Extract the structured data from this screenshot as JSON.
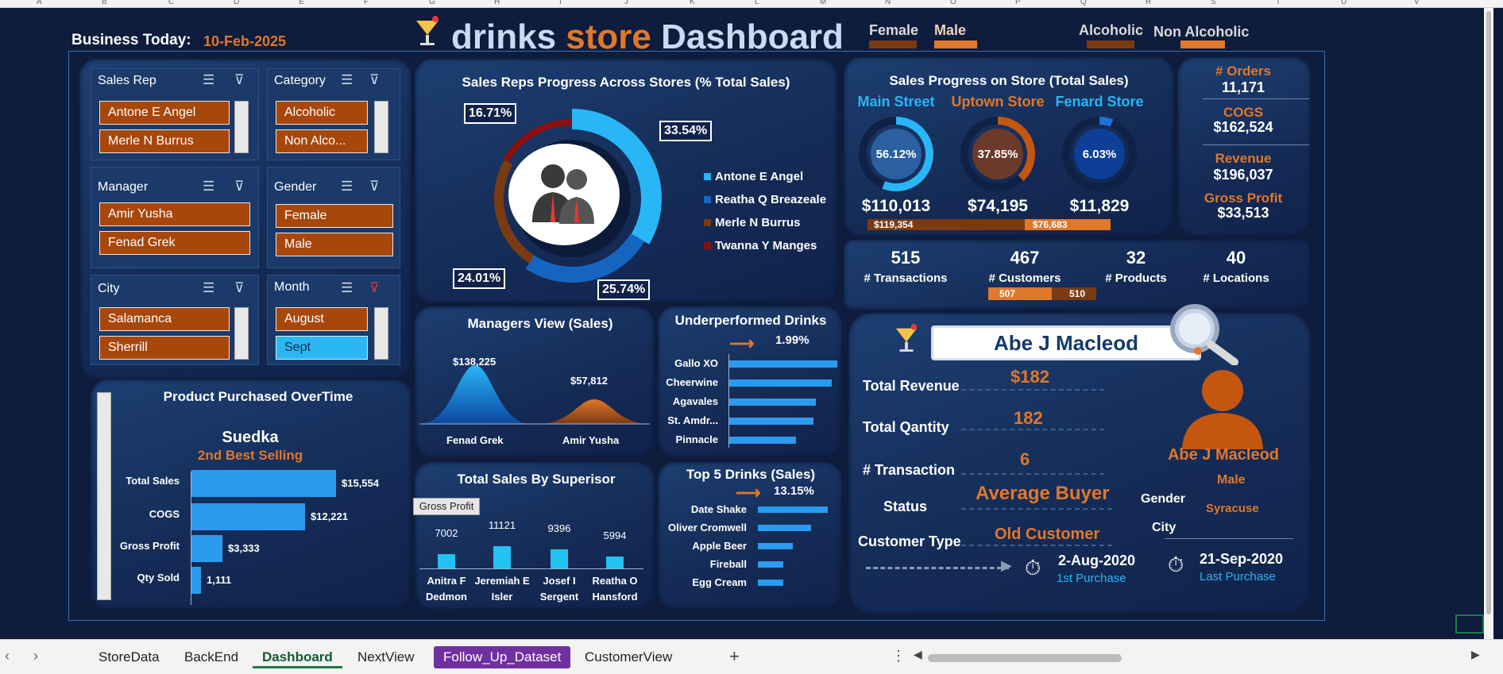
{
  "columns": [
    "A",
    "B",
    "C",
    "D",
    "E",
    "F",
    "G",
    "H",
    "I",
    "J",
    "K",
    "L",
    "M",
    "N",
    "O",
    "P",
    "Q",
    "R",
    "S",
    "T",
    "U",
    "V"
  ],
  "header": {
    "business_today_label": "Business Today:",
    "business_today_date": "10-Feb-2025",
    "title_part1": "drinks",
    "title_part2": "store",
    "title_part3": "Dashboard",
    "legend_female": "Female",
    "legend_male": "Male",
    "legend_alcoholic": "Alcoholic",
    "legend_non_alcoholic": "Non Alcoholic"
  },
  "slicers": {
    "sales_rep": {
      "title": "Sales Rep",
      "items": [
        "Antone E Angel",
        "Merle N Burrus"
      ]
    },
    "category": {
      "title": "Category",
      "items": [
        "Alcoholic",
        "Non Alco..."
      ]
    },
    "manager": {
      "title": "Manager",
      "items": [
        "Amir Yusha",
        "Fenad Grek"
      ]
    },
    "gender": {
      "title": "Gender",
      "items": [
        "Female",
        "Male"
      ]
    },
    "city": {
      "title": "City",
      "items": [
        "Salamanca",
        "Sherrill"
      ]
    },
    "month": {
      "title": "Month",
      "items": [
        "August",
        "Sept"
      ]
    }
  },
  "reps_chart": {
    "title": "Sales Reps Progress Across Stores (% Total Sales)",
    "labels": [
      "16.71%",
      "33.54%",
      "24.01%",
      "25.74%"
    ]
  },
  "chart_data": [
    {
      "type": "pie",
      "title": "Sales Reps Progress Across Stores (% Total Sales)",
      "series": [
        {
          "name": "Antone E Angel",
          "value": 33.54,
          "color": "#29b6f6"
        },
        {
          "name": "Reatha Q Breazeale",
          "value": 25.74,
          "color": "#1565c0"
        },
        {
          "name": "Merle N Burrus",
          "value": 24.01,
          "color": "#7a3a12"
        },
        {
          "name": "Twanna Y Manges",
          "value": 16.71,
          "color": "#8b1010"
        }
      ]
    },
    {
      "type": "area",
      "title": "Managers View (Sales)",
      "categories": [
        "Fenad Grek",
        "Amir Yusha"
      ],
      "values": [
        138225,
        57812
      ],
      "labels": [
        "$138,225",
        "$57,812"
      ]
    },
    {
      "type": "bar",
      "title": "Underperformed Drinks",
      "categories": [
        "Gallo XO",
        "Cheerwine",
        "Agavales",
        "St. Amdr...",
        "Pinnacle"
      ],
      "values": [
        100,
        95,
        80,
        78,
        62
      ]
    },
    {
      "type": "bar",
      "title": "Top 5 Drinks (Sales)",
      "categories": [
        "Date Shake",
        "Oliver Cromwell",
        "Apple Beer",
        "Fireball",
        "Egg Cream"
      ],
      "values": [
        100,
        76,
        50,
        36,
        36
      ]
    },
    {
      "type": "bar",
      "title": "Total Sales By Superisor",
      "categories": [
        "Anitra F Dedmon",
        "Jeremiah E Isler",
        "Josef I Sergent",
        "Reatha O Hansford"
      ],
      "values": [
        7002,
        11121,
        9396,
        5994
      ]
    },
    {
      "type": "bar",
      "title": "Product Purchased OverTime",
      "categories": [
        "Total Sales",
        "COGS",
        "Gross Profit",
        "Qty Sold"
      ],
      "values": [
        15554,
        12221,
        3333,
        1111
      ],
      "labels": [
        "$15,554",
        "$12,221",
        "$3,333",
        "1,111"
      ]
    }
  ],
  "managers": {
    "title": "Managers View (Sales)",
    "v1": "$138,225",
    "v2": "$57,812",
    "n1": "Fenad Grek",
    "n2": "Amir Yusha"
  },
  "underperformed": {
    "title": "Underperformed Drinks",
    "pct": "1.99%",
    "items": [
      "Gallo XO",
      "Cheerwine",
      "Agavales",
      "St. Amdr...",
      "Pinnacle"
    ]
  },
  "top5": {
    "title": "Top 5 Drinks (Sales)",
    "pct": "13.15%",
    "items": [
      "Date Shake",
      "Oliver Cromwell",
      "Apple Beer",
      "Fireball",
      "Egg Cream"
    ]
  },
  "superior": {
    "title": "Total Sales By Superisor",
    "button": "Gross Profit",
    "values": [
      "7002",
      "11121",
      "9396",
      "5994"
    ],
    "names": [
      [
        "Anitra F",
        "Dedmon"
      ],
      [
        "Jeremiah E",
        "Isler"
      ],
      [
        "Josef I",
        "Sergent"
      ],
      [
        "Reatha O",
        "Hansford"
      ]
    ]
  },
  "product": {
    "title": "Product Purchased OverTime",
    "name": "Suedka",
    "rank": "2nd Best Selling",
    "rows": [
      "Total Sales",
      "COGS",
      "Gross Profit",
      "Qty Sold"
    ],
    "values": [
      "$15,554",
      "$12,221",
      "$3,333",
      "1,111"
    ]
  },
  "store": {
    "title": "Sales Progress on Store (Total Sales)",
    "stores": [
      {
        "name": "Main Street",
        "pct": "56.12%",
        "value": "$110,013",
        "fill": 0.5612
      },
      {
        "name": "Uptown Store",
        "pct": "37.85%",
        "value": "$74,195",
        "fill": 0.3785
      },
      {
        "name": "Fenard Store",
        "pct": "6.03%",
        "value": "$11,829",
        "fill": 0.0603
      }
    ],
    "bar1": "$119,354",
    "bar2": "$76,683"
  },
  "kpis": {
    "orders_label": "# Orders",
    "orders": "11,171",
    "cogs_label": "COGS",
    "cogs": "$162,524",
    "revenue_label": "Revenue",
    "revenue": "$196,037",
    "gp_label": "Gross Profit",
    "gp": "$33,513"
  },
  "counts": {
    "transactions": "515",
    "transactions_label": "# Transactions",
    "customers": "467",
    "customers_label": "# Customers",
    "products": "32",
    "products_label": "# Products",
    "locations": "40",
    "locations_label": "# Locations",
    "cust_female": "507",
    "cust_male": "510"
  },
  "customer": {
    "search_name": "Abe J Macleod",
    "rev_label": "Total Revenue",
    "rev": "$182",
    "qty_label": "Total Qantity",
    "qty": "182",
    "tx_label": "# Transaction",
    "tx": "6",
    "status_label": "Status",
    "status": "Average Buyer",
    "type_label": "Customer Type",
    "type": "Old Customer",
    "name": "Abe J Macleod",
    "gender_label": "Gender",
    "gender": "Male",
    "city_label": "City",
    "city": "Syracuse",
    "first_date": "2-Aug-2020",
    "first_label": "1st Purchase",
    "last_date": "21-Sep-2020",
    "last_label": "Last Purchase"
  },
  "tabs": [
    "StoreData",
    "BackEnd",
    "Dashboard",
    "NextView",
    "Follow_Up_Dataset",
    "CustomerView"
  ],
  "colors": {
    "accent": "#e0782b",
    "panel": "#17315e",
    "bg": "#0e1c3d",
    "bar": "#2b9bf0"
  }
}
